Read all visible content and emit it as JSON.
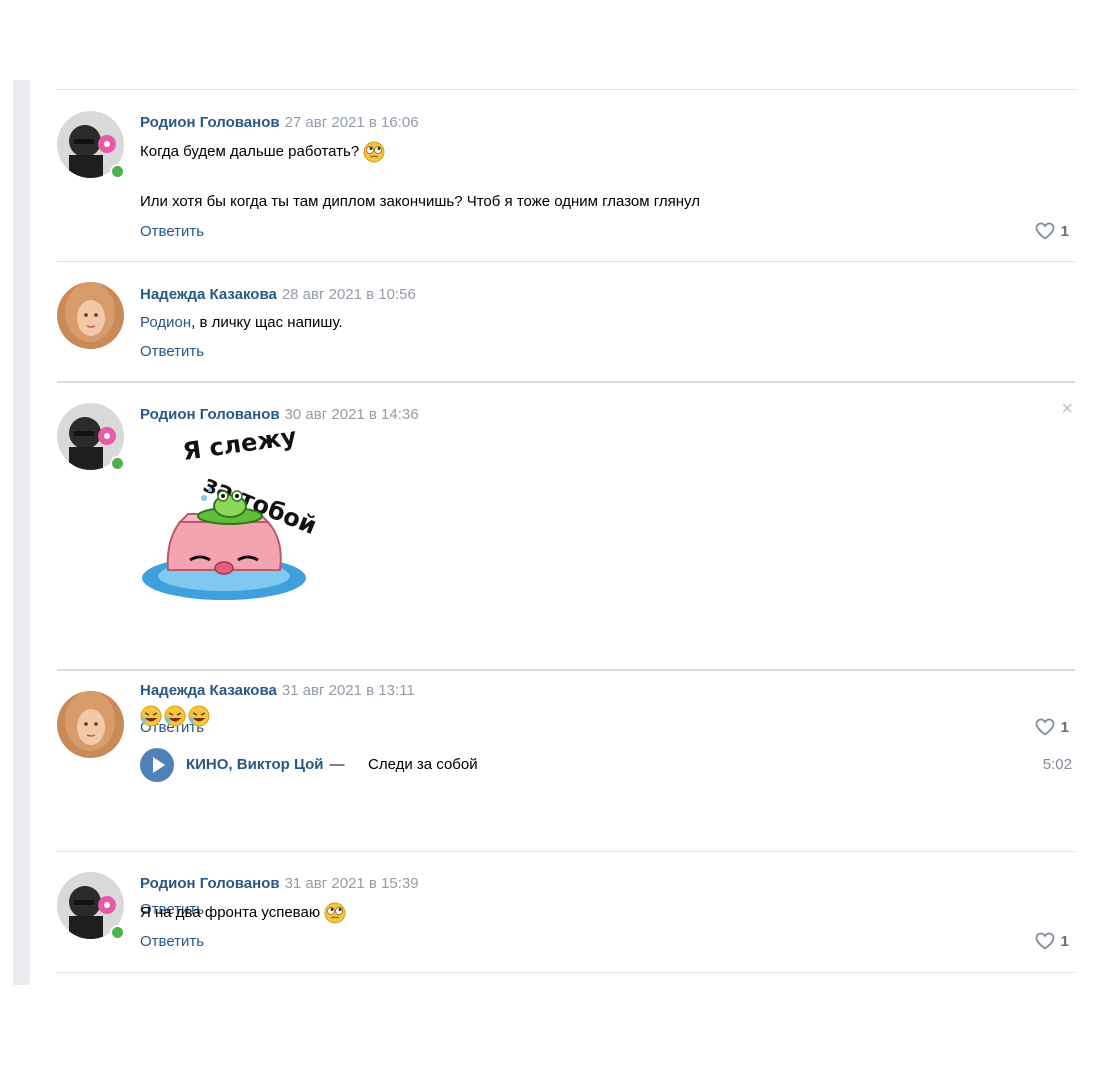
{
  "reply_label": "Ответить",
  "close_symbol": "×",
  "colors": {
    "link": "#2a5885",
    "date": "#939ca8",
    "online": "#4bb34b",
    "play": "#5181b8"
  },
  "comments": [
    {
      "author": "Родион Голованов",
      "date": "27 авг 2021 в 16:06",
      "line1": "Когда будем дальше работать?",
      "line2": "Или хотя бы когда ты там диплом закончишь? Чтоб я тоже одним глазом глянул",
      "likes": "1",
      "online": true
    },
    {
      "author": "Надежда Казакова",
      "date": "28 авг 2021 в 10:56",
      "mention": "Родион",
      "text": ", в личку щас напишу.",
      "online": false
    },
    {
      "author": "Родион Голованов",
      "date": "30 авг 2021 в 14:36",
      "sticker_text_line1": "Я слежу",
      "sticker_text_line2": "за тобой",
      "likes": "1",
      "online": true
    },
    {
      "author": "Надежда Казакова",
      "date": "31 авг 2021 в 13:11",
      "emoji": "rolling-on-floor-laughing x3",
      "audio": {
        "artist": "КИНО, Виктор Цой",
        "dash": "—",
        "title": "Следи за собой",
        "duration": "5:02"
      },
      "online": false
    },
    {
      "author": "Родион Голованов",
      "date": "31 авг 2021 в 15:39",
      "text": "Я на два фронта успеваю",
      "likes": "1",
      "online": true
    }
  ]
}
